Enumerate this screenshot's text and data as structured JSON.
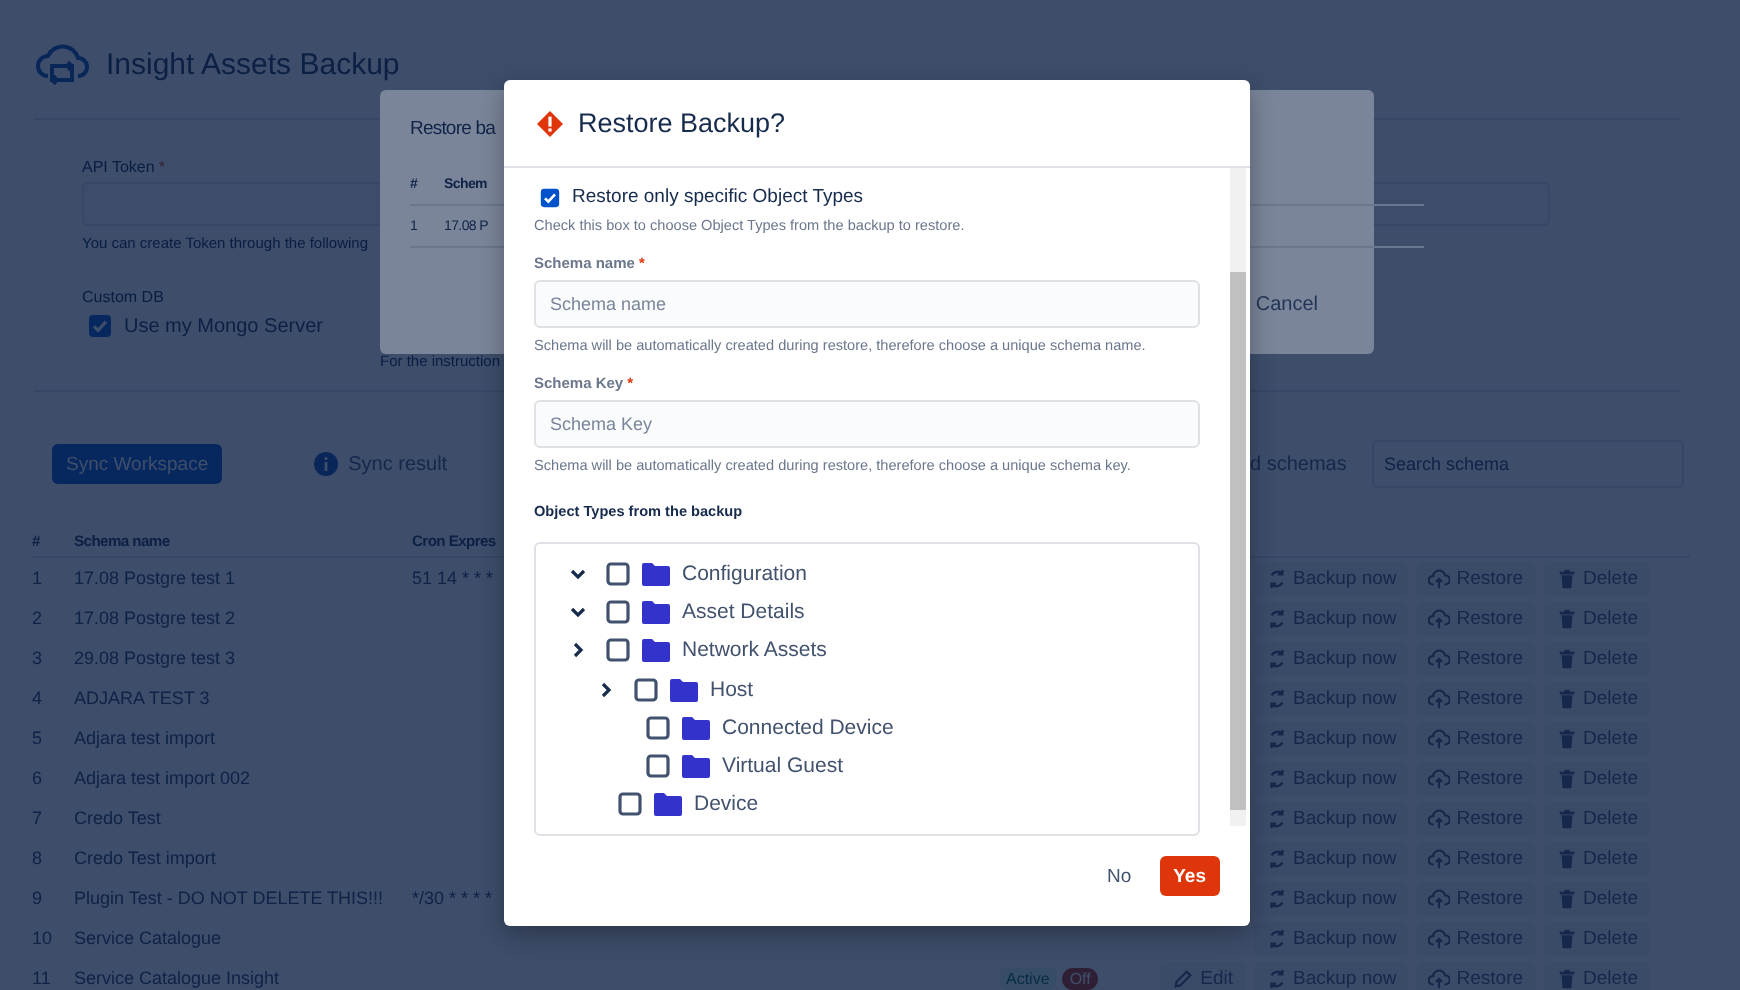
{
  "app": {
    "title": "Insight Assets Backup",
    "api_token": {
      "label": "API Token",
      "required_mark": "*",
      "hint": "You can create Token through the following"
    },
    "custom_db": {
      "label": "Custom DB",
      "option": "Use my Mongo Server",
      "checked": true
    },
    "instructions_note": "For the instruction",
    "sync_button": "Sync Workspace",
    "sync_result": "Sync result",
    "schemas_label": "d schemas",
    "search": {
      "placeholder": "Search schema"
    },
    "table": {
      "columns": [
        "#",
        "Schema name",
        "Cron Expres"
      ],
      "rows": [
        {
          "number": "1",
          "name": "17.08 Postgre test 1",
          "cron": "51 14 * * *",
          "actions": [
            {
              "kind": "backup",
              "label": "Backup now"
            },
            {
              "kind": "restore",
              "label": "Restore"
            },
            {
              "kind": "delete",
              "label": "Delete"
            }
          ]
        },
        {
          "number": "2",
          "name": "17.08 Postgre test 2",
          "actions": [
            {
              "kind": "backup",
              "label": "Backup now"
            },
            {
              "kind": "restore",
              "label": "Restore"
            },
            {
              "kind": "delete",
              "label": "Delete"
            }
          ]
        },
        {
          "number": "3",
          "name": "29.08 Postgre test 3",
          "actions": [
            {
              "kind": "backup",
              "label": "Backup now"
            },
            {
              "kind": "restore",
              "label": "Restore"
            },
            {
              "kind": "delete",
              "label": "Delete"
            }
          ]
        },
        {
          "number": "4",
          "name": "ADJARA TEST 3",
          "actions": [
            {
              "kind": "backup",
              "label": "Backup now"
            },
            {
              "kind": "restore",
              "label": "Restore"
            },
            {
              "kind": "delete",
              "label": "Delete"
            }
          ]
        },
        {
          "number": "5",
          "name": "Adjara test import",
          "actions": [
            {
              "kind": "backup",
              "label": "Backup now"
            },
            {
              "kind": "restore",
              "label": "Restore"
            },
            {
              "kind": "delete",
              "label": "Delete"
            }
          ]
        },
        {
          "number": "6",
          "name": "Adjara test import 002",
          "actions": [
            {
              "kind": "backup",
              "label": "Backup now"
            },
            {
              "kind": "restore",
              "label": "Restore"
            },
            {
              "kind": "delete",
              "label": "Delete"
            }
          ]
        },
        {
          "number": "7",
          "name": "Credo Test",
          "actions": [
            {
              "kind": "backup",
              "label": "Backup now"
            },
            {
              "kind": "restore",
              "label": "Restore"
            },
            {
              "kind": "delete",
              "label": "Delete"
            }
          ]
        },
        {
          "number": "8",
          "name": "Credo Test import",
          "actions": [
            {
              "kind": "backup",
              "label": "Backup now"
            },
            {
              "kind": "restore",
              "label": "Restore"
            },
            {
              "kind": "delete",
              "label": "Delete"
            }
          ]
        },
        {
          "number": "9",
          "name": "Plugin Test - DO NOT DELETE THIS!!!",
          "cron": "*/30 * * * *",
          "actions": [
            {
              "kind": "backup",
              "label": "Backup now"
            },
            {
              "kind": "restore",
              "label": "Restore"
            },
            {
              "kind": "delete",
              "label": "Delete"
            }
          ]
        },
        {
          "number": "10",
          "name": "Service Catalogue",
          "actions": [
            {
              "kind": "backup",
              "label": "Backup now"
            },
            {
              "kind": "restore",
              "label": "Restore"
            },
            {
              "kind": "delete",
              "label": "Delete"
            }
          ]
        },
        {
          "number": "11",
          "name": "Service Catalogue Insight",
          "status": "Active",
          "toggle": {
            "label": "Off",
            "on": false
          },
          "actions": [
            {
              "kind": "edit",
              "label": "Edit"
            },
            {
              "kind": "backup",
              "label": "Backup now"
            },
            {
              "kind": "restore",
              "label": "Restore"
            },
            {
              "kind": "delete",
              "label": "Delete"
            }
          ]
        }
      ]
    }
  },
  "back_dialog": {
    "title": "Restore ba",
    "columns": [
      "#",
      "Schem"
    ],
    "rows": [
      {
        "number": "1",
        "name": "17.08 P"
      }
    ],
    "cancel": "Cancel"
  },
  "dialog": {
    "title": "Restore Backup?",
    "specific_types": {
      "label": "Restore only specific Object Types",
      "checked": true,
      "hint": "Check this box to choose Object Types from the backup to restore."
    },
    "schema_name": {
      "label": "Schema name",
      "required_mark": "*",
      "placeholder": "Schema name",
      "hint": "Schema will be automatically created during restore, therefore choose a unique schema name."
    },
    "schema_key": {
      "label": "Schema Key",
      "required_mark": "*",
      "placeholder": "Schema Key",
      "hint": "Schema will be automatically created during restore, therefore choose a unique schema key."
    },
    "tree_label": "Object Types from the backup",
    "tree": [
      {
        "label": "Configuration",
        "kind": "branch",
        "expanded": true,
        "checked": false
      },
      {
        "label": "Asset Details",
        "kind": "branch",
        "expanded": true,
        "checked": false
      },
      {
        "label": "Network Assets",
        "kind": "branch",
        "expanded": false,
        "checked": false,
        "children": [
          {
            "label": "Host",
            "kind": "branch",
            "expanded": false,
            "checked": false,
            "children": [
              {
                "label": "Connected Device",
                "kind": "leaf",
                "checked": false
              },
              {
                "label": "Virtual Guest",
                "kind": "leaf",
                "checked": false
              }
            ]
          },
          {
            "label": "Device",
            "kind": "leaf",
            "checked": false
          }
        ]
      }
    ],
    "buttons": [
      {
        "kind": "secondary",
        "label": "No"
      },
      {
        "kind": "primary",
        "label": "Yes"
      }
    ]
  }
}
